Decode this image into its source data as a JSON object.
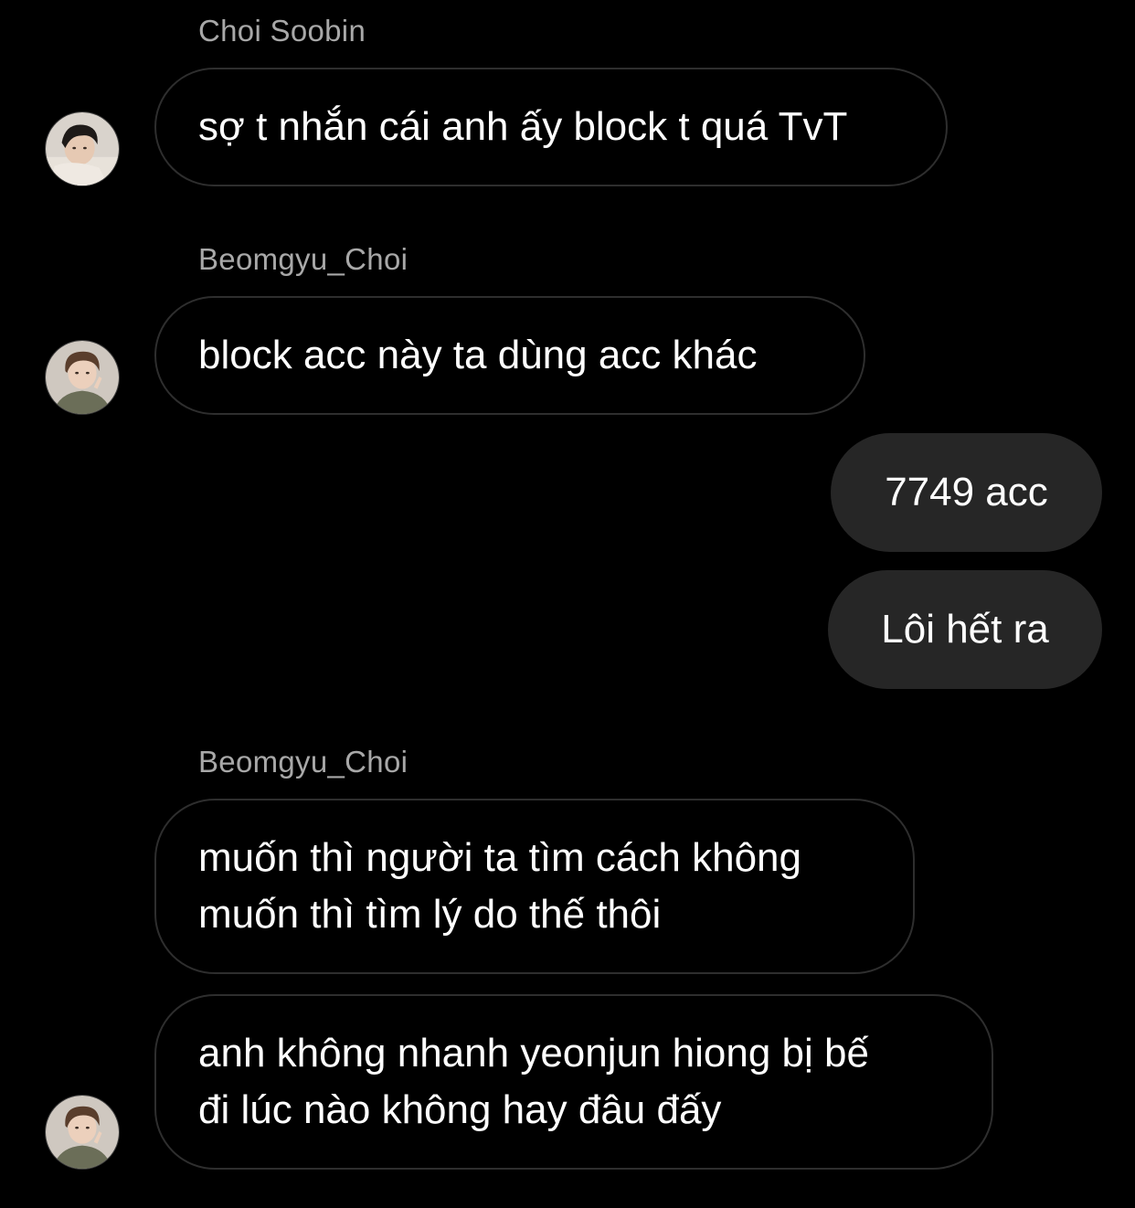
{
  "messages": [
    {
      "type": "name",
      "text": "Choi Soobin"
    },
    {
      "type": "in",
      "text": "sợ t nhắn cái anh ấy block t quá TvT"
    },
    {
      "type": "name",
      "text": "Beomgyu_Choi"
    },
    {
      "type": "in",
      "text": "block acc này ta dùng acc khác"
    },
    {
      "type": "out",
      "text": "7749 acc"
    },
    {
      "type": "out",
      "text": "Lôi hết ra"
    },
    {
      "type": "name",
      "text": "Beomgyu_Choi"
    },
    {
      "type": "in",
      "lines": [
        "muốn thì người ta tìm cách không",
        "muốn thì tìm lý do thế thôi"
      ]
    },
    {
      "type": "in",
      "lines": [
        "anh không nhanh yeonjun hiong bị bế",
        "đi lúc nào không hay đâu đấy"
      ]
    }
  ],
  "colors": {
    "background": "#000000",
    "sender_name": "#a8a8a8",
    "incoming_border": "#2e2e2e",
    "outgoing_bubble": "#262626",
    "text": "#ffffff"
  },
  "icons": {
    "avatar_soobin": "avatar-photo-soobin",
    "avatar_beomgyu": "avatar-photo-beomgyu"
  }
}
